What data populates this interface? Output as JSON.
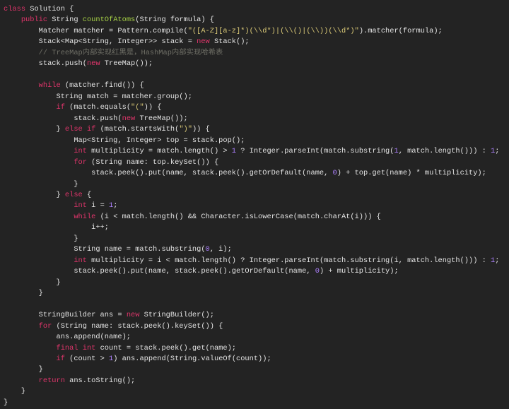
{
  "colors": {
    "background": "#232323",
    "text": "#e4e4e4",
    "keyword": "#e0356b",
    "function": "#a6d046",
    "string": "#dccb78",
    "number": "#ae81ff",
    "comment": "#6f6f66"
  },
  "code": {
    "language": "java",
    "lines": [
      [
        [
          "k",
          "class"
        ],
        [
          "t",
          " Solution {"
        ]
      ],
      [
        [
          "t",
          "    "
        ],
        [
          "k",
          "public"
        ],
        [
          "t",
          " String "
        ],
        [
          "f",
          "countOfAtoms"
        ],
        [
          "t",
          "(String formula) {"
        ]
      ],
      [
        [
          "t",
          "        Matcher matcher = Pattern.compile("
        ],
        [
          "s",
          "\"([A-Z][a-z]*)(\\\\d*)|(\\\\()|(\\\\))(\\\\d*)\""
        ],
        [
          "t",
          ").matcher(formula);"
        ]
      ],
      [
        [
          "t",
          "        Stack<Map<String, Integer>> stack = "
        ],
        [
          "k",
          "new"
        ],
        [
          "t",
          " Stack();"
        ]
      ],
      [
        [
          "c",
          "        // TreeMap内部实现红黑是，HashMap内部实现哈希表"
        ]
      ],
      [
        [
          "t",
          "        stack.push("
        ],
        [
          "k",
          "new"
        ],
        [
          "t",
          " TreeMap());"
        ]
      ],
      [],
      [
        [
          "t",
          "        "
        ],
        [
          "k",
          "while"
        ],
        [
          "t",
          " (matcher.find()) {"
        ]
      ],
      [
        [
          "t",
          "            String match = matcher.group();"
        ]
      ],
      [
        [
          "t",
          "            "
        ],
        [
          "k",
          "if"
        ],
        [
          "t",
          " (match.equals("
        ],
        [
          "s",
          "\"(\""
        ],
        [
          "t",
          ")) {"
        ]
      ],
      [
        [
          "t",
          "                stack.push("
        ],
        [
          "k",
          "new"
        ],
        [
          "t",
          " TreeMap());"
        ]
      ],
      [
        [
          "t",
          "            } "
        ],
        [
          "k",
          "else if"
        ],
        [
          "t",
          " (match.startsWith("
        ],
        [
          "s",
          "\")\""
        ],
        [
          "t",
          ")) {"
        ]
      ],
      [
        [
          "t",
          "                Map<String, Integer> top = stack.pop();"
        ]
      ],
      [
        [
          "t",
          "                "
        ],
        [
          "k",
          "int"
        ],
        [
          "t",
          " multiplicity = match.length() > "
        ],
        [
          "n",
          "1"
        ],
        [
          "t",
          " ? Integer.parseInt(match.substring("
        ],
        [
          "n",
          "1"
        ],
        [
          "t",
          ", match.length())) : "
        ],
        [
          "n",
          "1"
        ],
        [
          "t",
          ";"
        ]
      ],
      [
        [
          "t",
          "                "
        ],
        [
          "k",
          "for"
        ],
        [
          "t",
          " (String name: top.keySet()) {"
        ]
      ],
      [
        [
          "t",
          "                    stack.peek().put(name, stack.peek().getOrDefault(name, "
        ],
        [
          "n",
          "0"
        ],
        [
          "t",
          ") + top.get(name) * multiplicity);"
        ]
      ],
      [
        [
          "t",
          "                }"
        ]
      ],
      [
        [
          "t",
          "            } "
        ],
        [
          "k",
          "else"
        ],
        [
          "t",
          " {"
        ]
      ],
      [
        [
          "t",
          "                "
        ],
        [
          "k",
          "int"
        ],
        [
          "t",
          " i = "
        ],
        [
          "n",
          "1"
        ],
        [
          "t",
          ";"
        ]
      ],
      [
        [
          "t",
          "                "
        ],
        [
          "k",
          "while"
        ],
        [
          "t",
          " (i < match.length() && Character.isLowerCase(match.charAt(i))) {"
        ]
      ],
      [
        [
          "t",
          "                    i++;"
        ]
      ],
      [
        [
          "t",
          "                }"
        ]
      ],
      [
        [
          "t",
          "                String name = match.substring("
        ],
        [
          "n",
          "0"
        ],
        [
          "t",
          ", i);"
        ]
      ],
      [
        [
          "t",
          "                "
        ],
        [
          "k",
          "int"
        ],
        [
          "t",
          " multiplicity = i < match.length() ? Integer.parseInt(match.substring(i, match.length())) : "
        ],
        [
          "n",
          "1"
        ],
        [
          "t",
          ";"
        ]
      ],
      [
        [
          "t",
          "                stack.peek().put(name, stack.peek().getOrDefault(name, "
        ],
        [
          "n",
          "0"
        ],
        [
          "t",
          ") + multiplicity);"
        ]
      ],
      [
        [
          "t",
          "            }"
        ]
      ],
      [
        [
          "t",
          "        }"
        ]
      ],
      [],
      [
        [
          "t",
          "        StringBuilder ans = "
        ],
        [
          "k",
          "new"
        ],
        [
          "t",
          " StringBuilder();"
        ]
      ],
      [
        [
          "t",
          "        "
        ],
        [
          "k",
          "for"
        ],
        [
          "t",
          " (String name: stack.peek().keySet()) {"
        ]
      ],
      [
        [
          "t",
          "            ans.append(name);"
        ]
      ],
      [
        [
          "t",
          "            "
        ],
        [
          "k",
          "final int"
        ],
        [
          "t",
          " count = stack.peek().get(name);"
        ]
      ],
      [
        [
          "t",
          "            "
        ],
        [
          "k",
          "if"
        ],
        [
          "t",
          " (count > "
        ],
        [
          "n",
          "1"
        ],
        [
          "t",
          ") ans.append(String.valueOf(count));"
        ]
      ],
      [
        [
          "t",
          "        }"
        ]
      ],
      [
        [
          "t",
          "        "
        ],
        [
          "k",
          "return"
        ],
        [
          "t",
          " ans.toString();"
        ]
      ],
      [
        [
          "t",
          "    }"
        ]
      ],
      [
        [
          "t",
          "}"
        ]
      ]
    ]
  }
}
